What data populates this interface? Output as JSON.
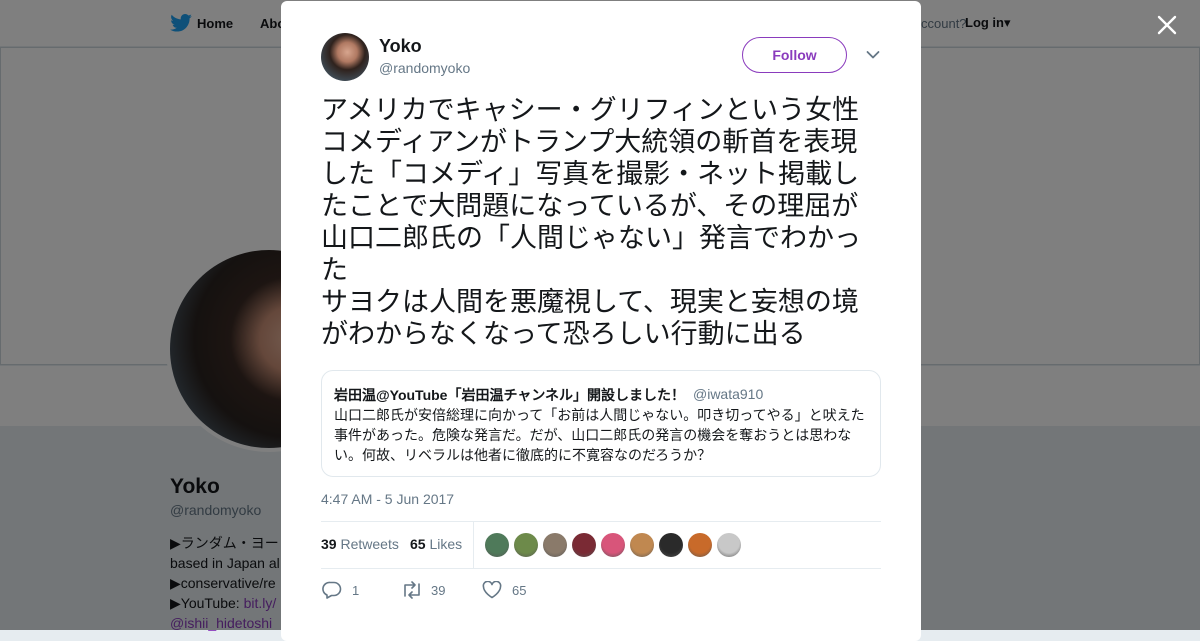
{
  "background": {
    "nav": {
      "home": "Home",
      "about": "Abo",
      "account_prompt": "ccount?",
      "login": "Log in▾"
    },
    "profile": {
      "name": "Yoko",
      "handle": "@randomyoko",
      "bio_lines": [
        "▶ランダム・ヨー",
        "based in Japan al",
        "▶conservative/re",
        "▶YouTube: "
      ],
      "bio_link": "bit.ly/",
      "bio_mention": "@ishii_hidetoshi"
    }
  },
  "modal": {
    "author": {
      "name": "Yoko",
      "handle": "@randomyoko"
    },
    "follow_label": "Follow",
    "tweet_text": "アメリカでキャシー・グリフィンという女性コメディアンがトランプ大統領の斬首を表現した「コメディ」写真を撮影・ネット掲載したことで大問題になっているが、その理屈が山口二郎氏の「人間じゃない」発言でわかった\nサヨクは人間を悪魔視して、現実と妄想の境がわからなくなって恐ろしい行動に出る",
    "quote": {
      "name": "岩田温@YouTube「岩田温チャンネル」開設しました！",
      "handle": "@iwata910",
      "text": "山口二郎氏が安倍総理に向かって「お前は人間じゃない。叩き切ってやる」と吠えた事件があった。危険な発言だ。だが、山口二郎氏の発言の機会を奪おうとは思わない。何故、リベラルは他者に徹底的に不寛容なのだろうか？"
    },
    "timestamp": "4:47 AM - 5 Jun 2017",
    "stats": {
      "retweets": "39",
      "retweets_label": "Retweets",
      "likes": "65",
      "likes_label": "Likes"
    },
    "liker_colors": [
      "#4f7a5a",
      "#6d8a4a",
      "#8a7a6a",
      "#7a2a34",
      "#d8557a",
      "#c08850",
      "#2a2a2a",
      "#c86a2a",
      "#c8c8c8"
    ],
    "actions": {
      "reply_count": "1",
      "retweet_count": "39",
      "like_count": "65"
    }
  },
  "colors": {
    "accent": "#8a3bbd",
    "twitter_blue": "#1da1f2",
    "muted": "#657786"
  }
}
